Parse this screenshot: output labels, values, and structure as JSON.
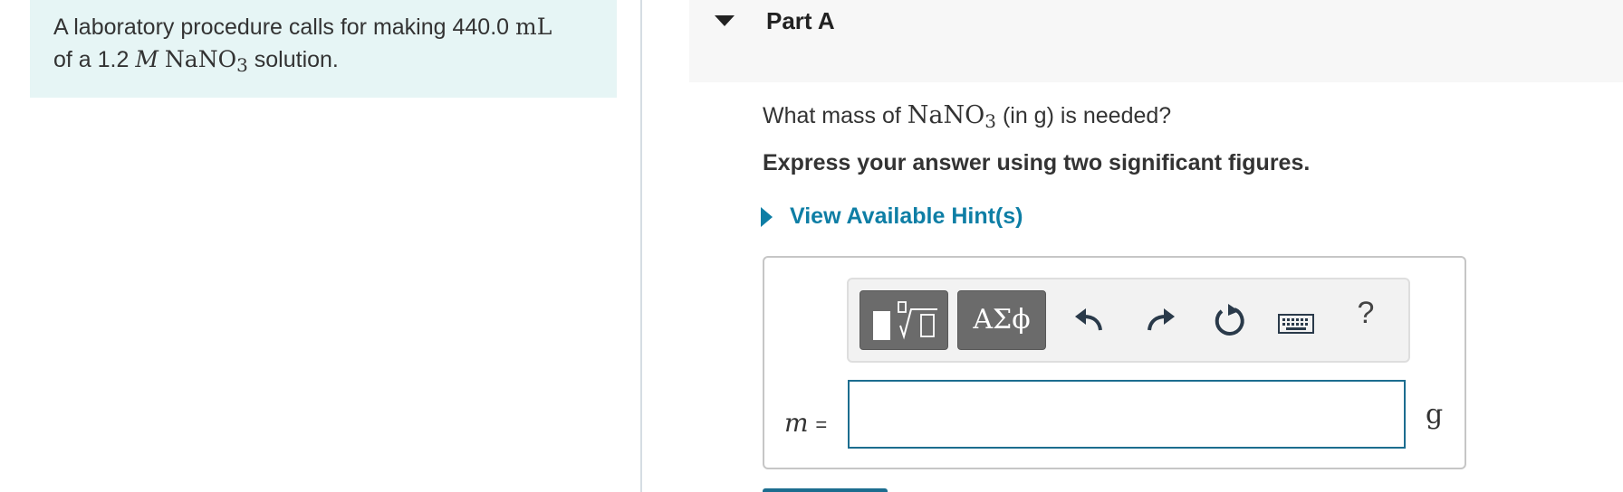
{
  "intro": {
    "text_before": "A laboratory procedure calls for making 440.0 ",
    "volume_unit": "mL",
    "text_mid": "of a 1.2 ",
    "molarity_symbol": "M",
    "compound_base": "NaNO",
    "compound_sub": "3",
    "text_after": " solution."
  },
  "part": {
    "title": "Part A"
  },
  "question": {
    "prefix": "What mass of ",
    "compound_base": "NaNO",
    "compound_sub": "3",
    "unit_paren": "(in g)",
    "suffix": " is needed?",
    "instruction": "Express your answer using two significant figures."
  },
  "hint": {
    "label": "View Available Hint(s)"
  },
  "toolbar": {
    "symbols_label": "ΑΣϕ",
    "help_label": "?",
    "icons": [
      "templates-icon",
      "undo-icon",
      "redo-icon",
      "reset-icon",
      "keyboard-icon",
      "help-icon"
    ]
  },
  "answer": {
    "variable": "m",
    "equals": "=",
    "value": "",
    "unit": "g"
  },
  "colors": {
    "intro_bg": "#e6f5f5",
    "link": "#0e7ea5",
    "input_border": "#1c6d8f",
    "toolbar_button": "#6b6b6b"
  }
}
